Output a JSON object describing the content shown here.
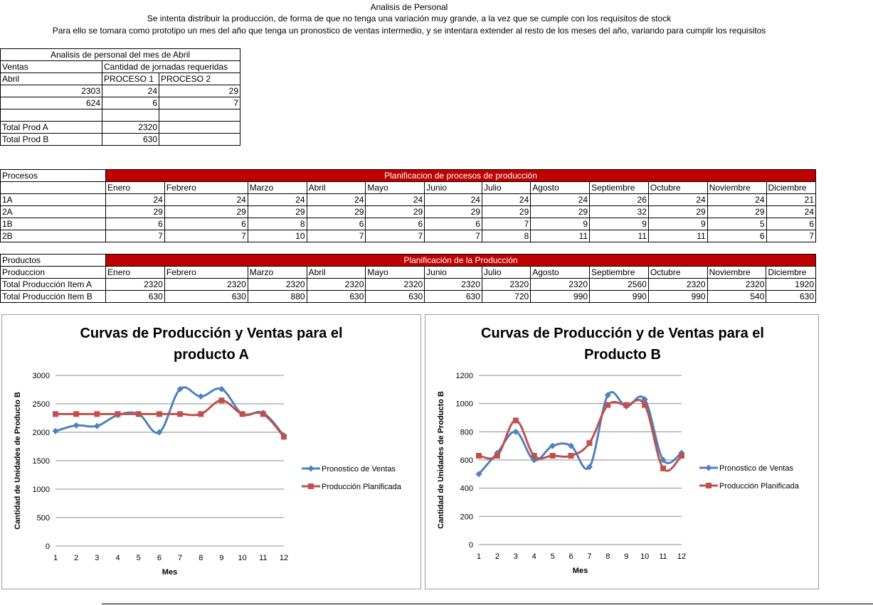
{
  "header": {
    "title": "Analisis de Personal",
    "line1": "Se intenta distribuir la producción, de forma de que no tenga una variación muy grande, a la vez que se cumple con los requisitos de stock",
    "line2": "Para ello se tomara como prototipo un mes del año que tenga un pronostico de ventas intermedio, y se intentara extender al resto de los meses del año, variando para cumplir los requisitos"
  },
  "april": {
    "title": "Analisis de personal del mes de Abril",
    "col0_h1": "Ventas",
    "col0_h2": "Abril",
    "jornadas": "Cantidad de jornadas requeridas",
    "p1": "PROCESO 1",
    "p2": "PROCESO 2",
    "rows": [
      [
        "2303",
        "24",
        "29"
      ],
      [
        "624",
        "6",
        "7"
      ]
    ],
    "total_a_label": "Total Prod A",
    "total_a": "2320",
    "total_b_label": "Total Prod B",
    "total_b": "630"
  },
  "months": [
    "Enero",
    "Febrero",
    "Marzo",
    "Abril",
    "Mayo",
    "Junio",
    "Julio",
    "Agosto",
    "Septiembre",
    "Octubre",
    "Noviembre",
    "Diciembre"
  ],
  "procesos": {
    "label": "Procesos",
    "title": "Planificacion de procesos de producción",
    "rows": [
      {
        "name": "1A",
        "values": [
          "24",
          "24",
          "24",
          "24",
          "24",
          "24",
          "24",
          "24",
          "26",
          "24",
          "24",
          "21"
        ]
      },
      {
        "name": "2A",
        "values": [
          "29",
          "29",
          "29",
          "29",
          "29",
          "29",
          "29",
          "29",
          "32",
          "29",
          "29",
          "24"
        ]
      },
      {
        "name": "1B",
        "values": [
          "6",
          "6",
          "8",
          "6",
          "6",
          "6",
          "7",
          "9",
          "9",
          "9",
          "5",
          "6"
        ]
      },
      {
        "name": "2B",
        "values": [
          "7",
          "7",
          "10",
          "7",
          "7",
          "7",
          "8",
          "11",
          "11",
          "11",
          "6",
          "7"
        ]
      }
    ]
  },
  "produccion": {
    "label": "Productos",
    "sublabel": "Produccion",
    "title": "Planificación de la Producción",
    "rows": [
      {
        "name": "Total Producción Item A",
        "values": [
          "2320",
          "2320",
          "2320",
          "2320",
          "2320",
          "2320",
          "2320",
          "2320",
          "2560",
          "2320",
          "2320",
          "1920"
        ]
      },
      {
        "name": "Total Producción Item B",
        "values": [
          "630",
          "630",
          "880",
          "630",
          "630",
          "630",
          "720",
          "990",
          "990",
          "990",
          "540",
          "630"
        ]
      }
    ]
  },
  "chart_data": [
    {
      "type": "line",
      "title": "Curvas de Producción y Ventas para el producto A",
      "title_lines": [
        "Curvas de Producción y Ventas para el",
        "producto A"
      ],
      "xlabel": "Mes",
      "ylabel": "Cantidad de Unidades de Producto B",
      "x": [
        1,
        2,
        3,
        4,
        5,
        6,
        7,
        8,
        9,
        10,
        11,
        12
      ],
      "ylim": [
        0,
        3000
      ],
      "yticks": [
        0,
        500,
        1000,
        1500,
        2000,
        2500,
        3000
      ],
      "grid": true,
      "legend": "right",
      "series": [
        {
          "name": "Pronostico de Ventas",
          "color": "#4f81bd",
          "marker": "diamond",
          "values": [
            2020,
            2120,
            2110,
            2303,
            2320,
            2000,
            2760,
            2630,
            2760,
            2320,
            2340,
            1940
          ]
        },
        {
          "name": "Producción Planificada",
          "color": "#c0504d",
          "marker": "square",
          "values": [
            2320,
            2320,
            2320,
            2320,
            2320,
            2320,
            2320,
            2320,
            2560,
            2320,
            2320,
            1920
          ]
        }
      ]
    },
    {
      "type": "line",
      "title": "Curvas de Producción y de Ventas para el Producto B",
      "title_lines": [
        "Curvas de Producción y de Ventas para el",
        "Producto B"
      ],
      "xlabel": "Mes",
      "ylabel": "Cantidad de Unidades de Producto B",
      "x": [
        1,
        2,
        3,
        4,
        5,
        6,
        7,
        8,
        9,
        10,
        11,
        12
      ],
      "ylim": [
        0,
        1200
      ],
      "yticks": [
        0,
        200,
        400,
        600,
        800,
        1000,
        1200
      ],
      "grid": true,
      "legend": "right",
      "series": [
        {
          "name": "Pronostico de Ventas",
          "color": "#4f81bd",
          "marker": "diamond",
          "values": [
            500,
            650,
            800,
            600,
            700,
            700,
            550,
            1060,
            980,
            1030,
            600,
            650
          ]
        },
        {
          "name": "Producción Planificada",
          "color": "#c0504d",
          "marker": "square",
          "values": [
            630,
            630,
            880,
            630,
            630,
            630,
            720,
            990,
            990,
            990,
            540,
            630
          ]
        }
      ]
    }
  ]
}
